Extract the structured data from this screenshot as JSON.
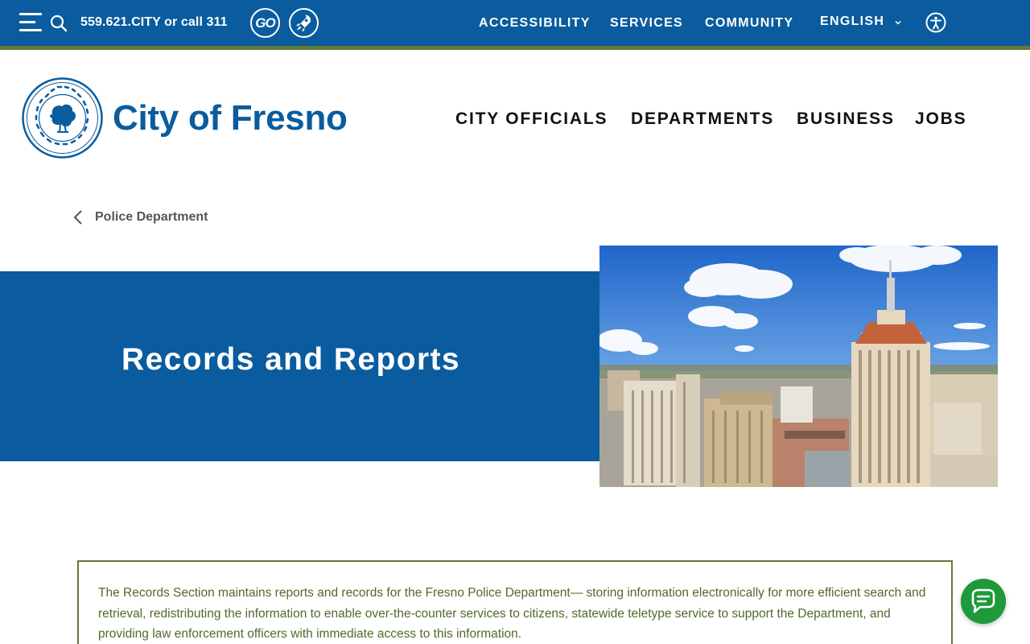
{
  "topbar": {
    "phone": "559.621.CITY or call 311",
    "go_logo_text": "GO",
    "links": [
      "ACCESSIBILITY",
      "SERVICES",
      "COMMUNITY"
    ],
    "language": "ENGLISH",
    "icons": {
      "menu": "hamburger-menu-icon",
      "search": "search-icon",
      "rocket": "rocket-logo-icon",
      "language": "chevron-down-icon",
      "accessibility": "accessibility-person-icon"
    },
    "colors": {
      "bar": "#0a5c9e",
      "rule": "#5f7a3a"
    }
  },
  "header": {
    "site_title": "City of Fresno",
    "seal_icon": "city-seal-icon",
    "nav": [
      "CITY OFFICIALS",
      "DEPARTMENTS",
      "BUSINESS",
      "JOBS"
    ]
  },
  "breadcrumb": {
    "label": "Police Department",
    "icon": "chevron-left-icon"
  },
  "hero": {
    "title": "Records and Reports",
    "image": "downtown-fresno-skyline-photo",
    "band_color": "#0a5c9e"
  },
  "intro": {
    "text": "The Records Section maintains reports and records for the Fresno Police Department— storing information electronically for more efficient search and retrieval, redistributing the information to enable over-the-counter services to citizens, statewide teletype service to support the Department, and providing law enforcement officers with immediate access to this information.",
    "border_color": "#5f7a3a",
    "text_color": "#4f6a2e"
  },
  "chat": {
    "icon": "chat-bubble-icon",
    "color": "#1f9a3a"
  }
}
